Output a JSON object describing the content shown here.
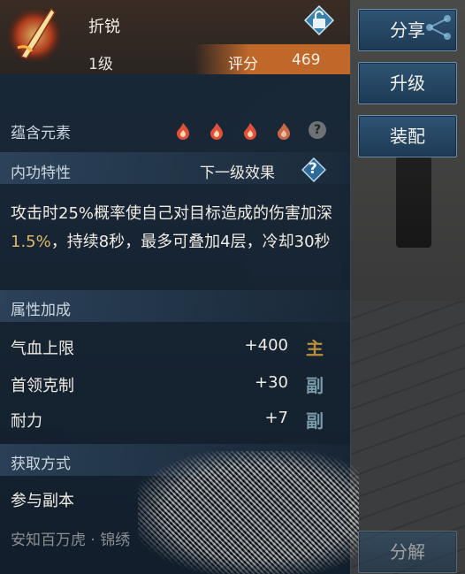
{
  "item": {
    "name": "折锐",
    "level": "1级",
    "score_label": "评分",
    "score_value": "469"
  },
  "elements": {
    "label": "蕴含元素",
    "flame_count": 4,
    "help": "?"
  },
  "inner_skill": {
    "label": "内功特性",
    "next_level": "下一级效果",
    "help": "?",
    "description_parts": [
      "攻击时25%概率使自己对目标造成的伤害加深",
      "1.5%",
      "，持续8秒，最多可叠加4层，冷却30秒"
    ]
  },
  "attributes": {
    "label": "属性加成",
    "rows": [
      {
        "name": "气血上限",
        "value": "+400",
        "tag": "主"
      },
      {
        "name": "首领克制",
        "value": "+30",
        "tag": "副"
      },
      {
        "name": "耐力",
        "value": "+7",
        "tag": "副"
      }
    ]
  },
  "acquire": {
    "label": "获取方式",
    "source": "参与副本",
    "source_sub": "安知百万虎 · 锦绣"
  },
  "buttons": {
    "share": "分享",
    "upgrade": "升级",
    "equip": "装配",
    "decompose": "分解"
  },
  "colors": {
    "highlight": "#e0b86a",
    "tag_main": "#b8903c",
    "tag_sub": "#7a9aa8",
    "score_bar": "#c0672a"
  }
}
